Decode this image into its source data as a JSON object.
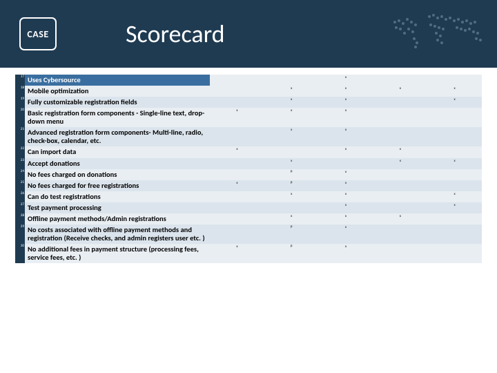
{
  "header": {
    "logo_text": "CASE",
    "title": "Scorecard"
  },
  "columns": [
    "",
    "",
    "",
    "",
    ""
  ],
  "rows": [
    {
      "num": "17",
      "label": "Uses Cybersource",
      "marks": [
        "",
        "",
        "x",
        "",
        ""
      ],
      "cls": "highlight"
    },
    {
      "num": "18",
      "label": "Mobile optimization",
      "marks": [
        "",
        "x",
        "x",
        "x",
        "x"
      ],
      "cls": "band-a"
    },
    {
      "num": "19",
      "label": "Fully customizable registration fields",
      "marks": [
        "",
        "x",
        "x",
        "",
        "x"
      ],
      "cls": "band-b"
    },
    {
      "num": "20",
      "label": "Basic registration form components - Single-line text, drop-down menu",
      "marks": [
        "x",
        "x",
        "x",
        "",
        ""
      ],
      "cls": "band-a"
    },
    {
      "num": "21",
      "label": "Advanced registration form components- Multi-line, radio, check-box, calendar, etc.",
      "marks": [
        "",
        "x",
        "x",
        "",
        ""
      ],
      "cls": "band-b"
    },
    {
      "num": "22",
      "label": "Can import data",
      "marks": [
        "x",
        "",
        "x",
        "x",
        ""
      ],
      "cls": "band-a"
    },
    {
      "num": "23",
      "label": "Accept donations",
      "marks": [
        "",
        "x",
        "",
        "x",
        "x"
      ],
      "cls": "band-b"
    },
    {
      "num": "24",
      "label": "No fees charged on donations",
      "marks": [
        "",
        "P",
        "x",
        "",
        ""
      ],
      "cls": "band-a"
    },
    {
      "num": "25",
      "label": "No fees charged for free registrations",
      "marks": [
        "x",
        "P",
        "x",
        "",
        ""
      ],
      "cls": "band-b"
    },
    {
      "num": "26",
      "label": "Can do test registrations",
      "marks": [
        "",
        "x",
        "x",
        "",
        "x"
      ],
      "cls": "band-a"
    },
    {
      "num": "27",
      "label": "Test payment processing",
      "marks": [
        "",
        "",
        "x",
        "",
        "x"
      ],
      "cls": "band-b"
    },
    {
      "num": "28",
      "label": "Offline payment methods/Admin registrations",
      "marks": [
        "",
        "x",
        "x",
        "x",
        ""
      ],
      "cls": "band-a"
    },
    {
      "num": "29",
      "label": "No costs associated with offline payment methods and registration (Receive checks, and admin registers user etc. )",
      "marks": [
        "",
        "P",
        "x",
        "",
        ""
      ],
      "cls": "band-b"
    },
    {
      "num": "30",
      "label": "No additional fees in payment structure (processing fees, service fees, etc. )",
      "marks": [
        "x",
        "P",
        "x",
        "",
        ""
      ],
      "cls": "band-a"
    }
  ]
}
